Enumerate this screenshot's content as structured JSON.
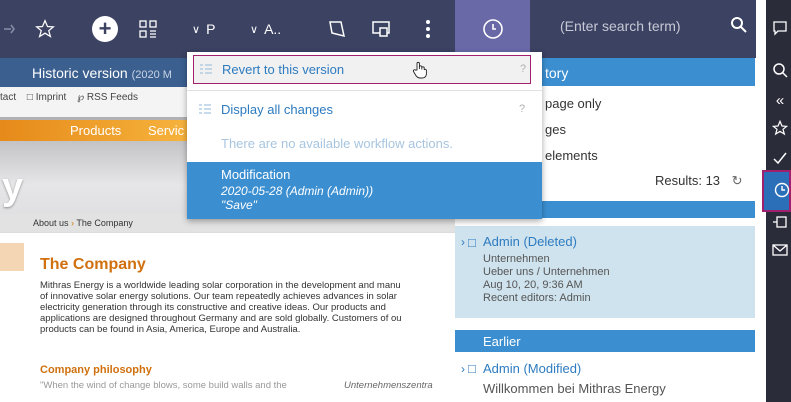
{
  "toolbar": {
    "dropdown_p": "P",
    "dropdown_a": "A..",
    "search_placeholder": "(Enter search term)"
  },
  "page": {
    "historic_title": "Historic version",
    "historic_date": "(2020 M",
    "util_contact": "tact",
    "util_imprint": "Imprint",
    "util_rss": "RSS Feeds",
    "nav_products": "Products",
    "nav_services": "Servic",
    "banner_letter": "y",
    "breadcrumb_about": "About us",
    "breadcrumb_company": "The Company",
    "heading": "The Company",
    "paragraph_lines": [
      "Mithras Energy is a worldwide leading solar corporation in the development and manu",
      "of innovative solar energy solutions. Our team repeatedly achieves advances in solar",
      "electricity generation through its constructive and creative ideas. Our products and",
      "applications are designed throughout Germany and are sold globally. Customers of ou",
      "products can be found in Asia, America, Europe and Australia."
    ],
    "subheading": "Company philosophy",
    "quote": "\"When the wind of change blows, some build walls and the",
    "quote_right": "Unternehmenszentra"
  },
  "history_panel": {
    "header": "tory",
    "opt1": "page only",
    "opt2": "ges",
    "opt3": "elements",
    "results_label": "Results: 13",
    "card_title": "Admin (Deleted)",
    "card_line1": "Unternehmen",
    "card_line2": "Ueber uns / Unternehmen",
    "card_line3": "Aug 10, 20, 9:36 AM",
    "card_line4": "Recent editors: Admin",
    "earlier": "Earlier",
    "item_title": "Admin (Modified)",
    "item_sub": "Willkommen bei Mithras Energy"
  },
  "dropdown": {
    "revert_label": "Revert to this version",
    "display_label": "Display all changes",
    "help_glyph": "?",
    "no_actions": "There are no available workflow actions.",
    "mod_title": "Modification",
    "mod_date": "2020-05-28 (Admin (Admin))",
    "mod_save": "\"Save\""
  },
  "colors": {
    "toolbar": "#3c4262",
    "accent": "#3b8fd1",
    "highlight_border": "#a0206e",
    "orange": "#d0700e"
  }
}
